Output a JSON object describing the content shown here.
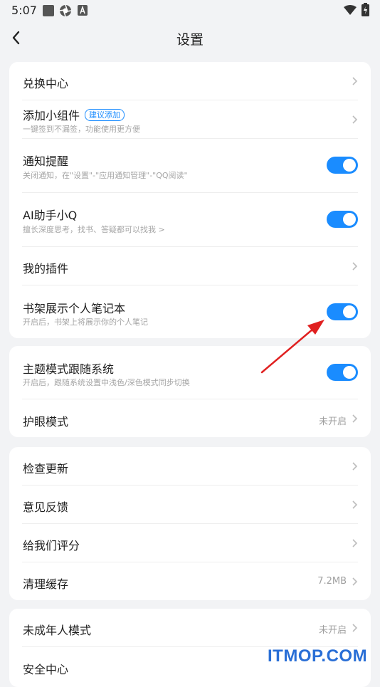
{
  "status_bar": {
    "time": "5:07"
  },
  "header": {
    "title": "设置"
  },
  "group1": [
    {
      "label": "兑换中心"
    },
    {
      "label": "添加小组件",
      "badge": "建议添加",
      "sub": "一键签到不漏签，功能使用更方便"
    },
    {
      "label": "通知提醒",
      "sub": "关闭通知，在\"设置\"-\"应用通知管理\"-\"QQ阅读\"",
      "toggle_on": true
    },
    {
      "label": "AI助手小Q",
      "sub": "擅长深度思考，找书、答疑都可以找我 >",
      "toggle_on": true
    },
    {
      "label": "我的插件"
    },
    {
      "label": "书架展示个人笔记本",
      "sub": "开启后，书架上将展示你的个人笔记",
      "toggle_on": true
    }
  ],
  "group2": [
    {
      "label": "主题模式跟随系统",
      "sub": "开启后，跟随系统设置中浅色/深色模式同步切换",
      "toggle_on": true
    },
    {
      "label": "护眼模式",
      "value": "未开启"
    }
  ],
  "group3": [
    {
      "label": "检查更新"
    },
    {
      "label": "意见反馈"
    },
    {
      "label": "给我们评分"
    },
    {
      "label": "清理缓存",
      "value": "7.2MB"
    }
  ],
  "group4": [
    {
      "label": "未成年人模式",
      "value": "未开启"
    },
    {
      "label": "安全中心"
    }
  ],
  "watermark": "ITMOP.COM",
  "colors": {
    "accent": "#1a8cff",
    "annotation_arrow": "#e02020"
  }
}
